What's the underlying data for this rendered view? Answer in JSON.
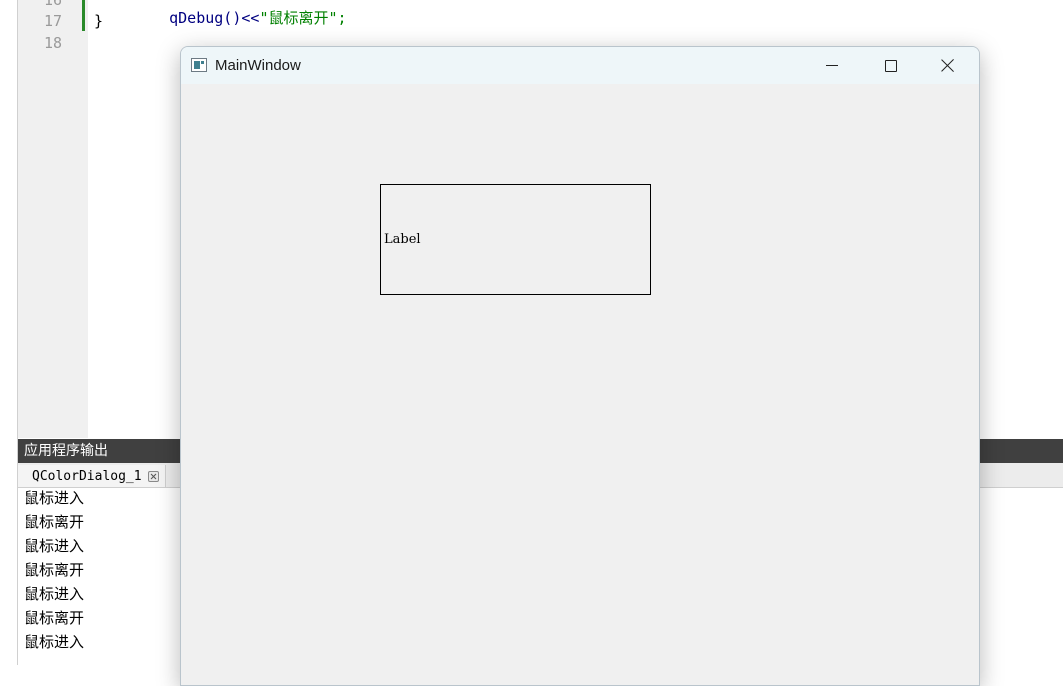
{
  "editor": {
    "line_numbers": [
      "16",
      "17",
      "18"
    ],
    "code_line_16_prefix": "qDebug()<<",
    "code_line_16_string": "\"鼠标离开\";",
    "code_line_17": "}"
  },
  "output_panel": {
    "header": "应用程序输出",
    "tab_label": "QColorDialog_1",
    "lines": [
      "鼠标进入",
      "鼠标离开",
      "鼠标进入",
      "鼠标离开",
      "鼠标进入",
      "鼠标离开",
      "鼠标进入"
    ]
  },
  "main_window": {
    "title": "MainWindow",
    "label_text": "Label"
  },
  "icons": {
    "app": "app-window-icon",
    "minimize": "minimize-icon",
    "maximize": "maximize-icon",
    "close": "close-icon",
    "tab_close": "tab-close-icon"
  }
}
